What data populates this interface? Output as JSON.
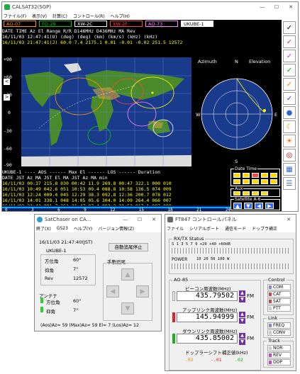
{
  "calsat": {
    "title": "CALSAT32(SGP)",
    "menu": [
      "ファイル(F)",
      "表示(V)",
      "計算(C)",
      "コントロール(R)",
      "ヘルプ(H)"
    ],
    "tabs": [
      {
        "label": "AO-07",
        "bg": "#000000",
        "fg": "#ff9900",
        "border": "#ff9900"
      },
      {
        "label": "FO-29",
        "bg": "#000000",
        "fg": "#00cc00",
        "border": "#00cc00"
      },
      {
        "label": "XW-2C",
        "bg": "#000000",
        "fg": "#ffffff",
        "border": "#ffffff"
      },
      {
        "label": "XW-2F",
        "bg": "#000000",
        "fg": "#ff4444",
        "border": "#ff4444"
      },
      {
        "label": "AO-73",
        "bg": "#000000",
        "fg": "#ff88ff",
        "border": "#ff88ff"
      },
      {
        "label": "UKUBE-1",
        "bg": "#ffffff",
        "fg": "#000000",
        "border": "#ffffff"
      }
    ],
    "header_line1": " DATE      TIME      Az     El    Range    R/R   D146MHz D436MHz   MA    Rev",
    "header_line2": "                  (deg)  (deg)   (km)   (km/s)  (kHz)   (kHz)",
    "header_line3": "16/11/03 12:47:41(U) (deg)  (deg)   (km)   (km/s)  (kHz)   (kHz)",
    "header_line4": "16/11/03 21:47:41(J)  60.0   7.4  2175.1   0.01   -0.01   -0.02   251.5  12572",
    "map_y_labels": [
      "+90",
      "+60",
      "+30",
      "0",
      "-30",
      "-60",
      "-90"
    ],
    "map_x_labels": [
      "0",
      "60",
      "120",
      "180",
      "240",
      "300",
      "360"
    ],
    "polar": {
      "title_left": "Azimuth",
      "title_center": "N",
      "title_right": "Elevation",
      "west": "W",
      "east": "E",
      "south": "S"
    },
    "pass_table": {
      "header1": "UKUBE-1  ----  AOS  ------  Max El  ------  LOS ------  Duration",
      "header2": " DATE      JST    Az   MA    JST    El   MA    JST    Az   MA   min",
      "rows": [
        "16/11/03 00:37 215.8 030   00:42 11.9 269.8   00:47 322.1 000  010",
        "16/11/03 10:49 042.6 051   10:53 09.4 088.8   10:58 136.5 074  009",
        "16/11/03 12:24 009.4 045   12:29 38.3 092.8   12:36 200.7 078  012",
        "16/11/03 14:01 338.1 048   14:05 05.6 304.0   14:09 264.4 066  007",
        "16/11/03 21:42 001.7 251   21:47 07.4 002.2   21:52 017.1 007  008"
      ]
    },
    "bottom_axis": [
      "0",
      "3",
      "6",
      "9",
      "12",
      "15",
      "18",
      "21",
      "24"
    ],
    "side_panel": {
      "date_time": "Date Time",
      "aux": "Aux",
      "satellite": "Satellite  A-6"
    }
  },
  "satchaser": {
    "title": "SatChaser on CA...",
    "menu": [
      "終了(X)",
      "GS23",
      "ヘルプ(Y)",
      "バージョン情報(Z)"
    ],
    "datetime": "16/11/03 21:47:40(JST)",
    "auto_track_button": "自動追尾停止",
    "sat_name": "UKUBE-1",
    "az_label": "方位角",
    "az_value": "60°",
    "el_label": "仰角",
    "el_value": "7°",
    "rev_label": "Rev",
    "rev_value": "12572",
    "manual_label": "手動追尾",
    "antenna_label": "アンテナ",
    "ant_az_label": "方位角",
    "ant_az_value": "60°",
    "ant_el_label": "仰角",
    "ant_el_value": "7°",
    "footer": "(Aos)Az= 59  (Max)Az= 59 El= 7  (Los)Az= 12"
  },
  "ft847": {
    "title": "FT847 コントロールパネル",
    "menu": [
      "ファイル",
      "シリアルポート",
      "通信モード",
      "ドップラ補正"
    ],
    "rxtx_title": "RX/TX Status",
    "s_scale": "S  1    3    5    7    9   +20  +40  +60dB",
    "power_label": "POWER",
    "power_scale": "10      20      50     100  W",
    "sat_group": "AO-85",
    "beacon_label": "ビーコン周波数(MHz)",
    "beacon_value": "435.79502",
    "beacon_mode": "FM",
    "uplink_label": "アップリンク周波数(MHz)",
    "uplink_value": "145.94999",
    "uplink_mode": "FM",
    "downlink_label": "ダウンリンク周波数(MHz)",
    "downlink_value": "435.85002",
    "downlink_mode": "FM",
    "doppler_label": "ドップラーシフト補正値(kHz)",
    "doppler_values": [
      ".02",
      "-.01",
      ".02"
    ],
    "control_title": "Control",
    "control_items": [
      "COM",
      "CAT",
      "SAT",
      "PTT"
    ],
    "link_title": "Link",
    "link_items": [
      "FREQ",
      "CONV"
    ],
    "track_title": "Track",
    "track_items": [
      "NOR",
      "REV",
      "DOP"
    ]
  }
}
